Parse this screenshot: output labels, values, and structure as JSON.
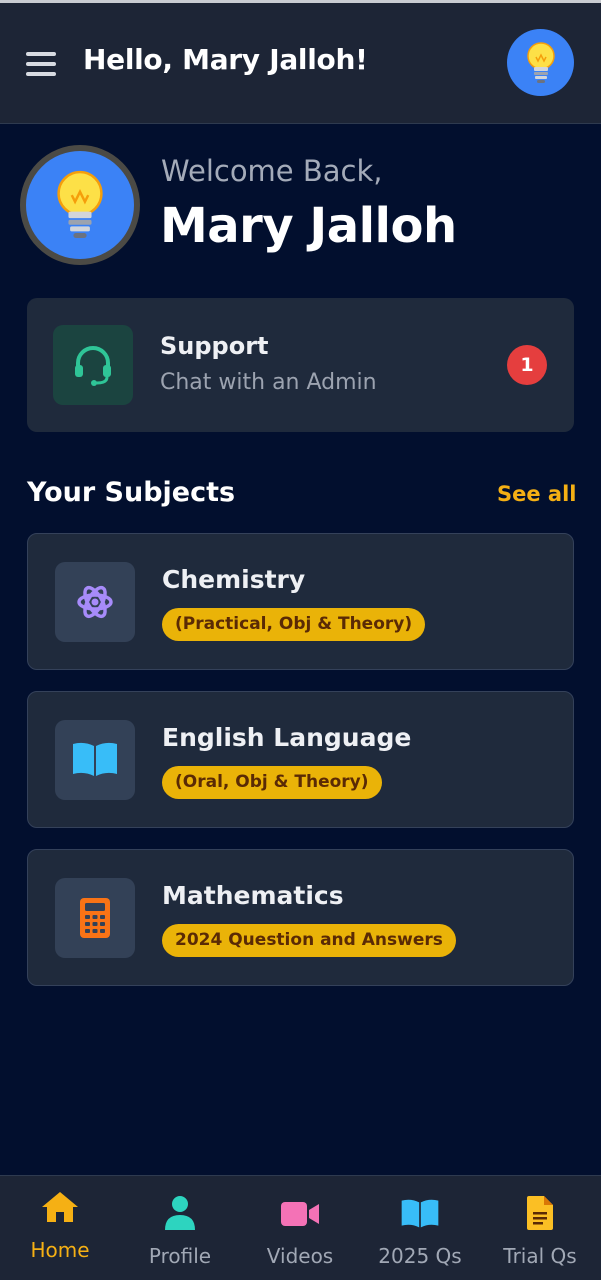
{
  "header": {
    "greeting": "Hello, Mary Jalloh!",
    "menu_icon": "hamburger-menu-icon",
    "avatar_icon": "lightbulb-icon"
  },
  "welcome": {
    "subtitle": "Welcome Back,",
    "name": "Mary Jalloh",
    "avatar_icon": "lightbulb-icon"
  },
  "support": {
    "title": "Support",
    "subtitle": "Chat with an Admin",
    "badge_count": "1",
    "icon": "headset-icon",
    "icon_color": "#2fc597"
  },
  "subjects_section": {
    "title": "Your Subjects",
    "see_all_label": "See all",
    "items": [
      {
        "name": "Chemistry",
        "tag": "(Practical, Obj & Theory)",
        "icon": "atom-icon",
        "icon_color": "#a78bfa"
      },
      {
        "name": "English Language",
        "tag": "(Oral, Obj & Theory)",
        "icon": "open-book-icon",
        "icon_color": "#38bdf8"
      },
      {
        "name": "Mathematics",
        "tag": "2024 Question and Answers",
        "icon": "calculator-icon",
        "icon_color": "#f97316"
      }
    ]
  },
  "bottom_nav": {
    "active_color": "#f5b014",
    "items": [
      {
        "label": "Home",
        "icon": "home-icon",
        "color": "#f5b014",
        "active": true
      },
      {
        "label": "Profile",
        "icon": "user-icon",
        "color": "#2dd4bf",
        "active": false
      },
      {
        "label": "Videos",
        "icon": "video-camera-icon",
        "color": "#f472b6",
        "active": false
      },
      {
        "label": "2025 Qs",
        "icon": "open-book-icon",
        "color": "#38bdf8",
        "active": false
      },
      {
        "label": "Trial Qs",
        "icon": "document-icon",
        "color": "#fbbf24",
        "active": false
      }
    ]
  }
}
